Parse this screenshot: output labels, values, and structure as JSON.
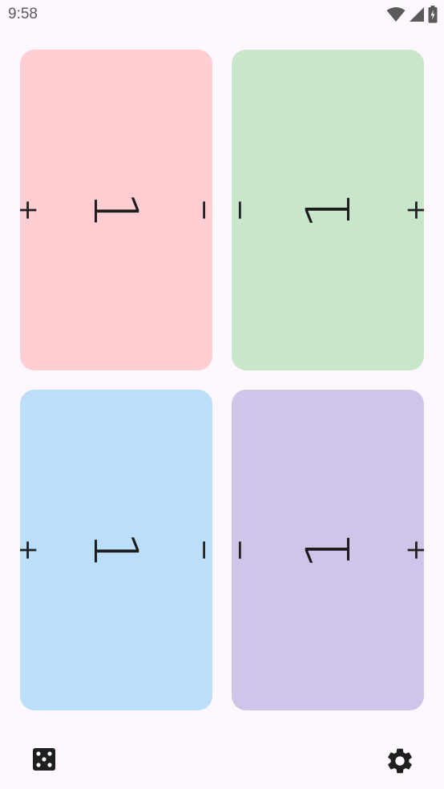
{
  "status_bar": {
    "time": "9:58",
    "icons": [
      "wifi-icon",
      "cellular-signal-icon",
      "battery-charging-icon"
    ]
  },
  "players": [
    {
      "name": "player-1",
      "color": "#FFCDD2",
      "life": "1",
      "decrement_label": "−",
      "increment_label": "+",
      "orientation": "rotated-clockwise"
    },
    {
      "name": "player-2",
      "color": "#C8E6C9",
      "life": "1",
      "decrement_label": "−",
      "increment_label": "+",
      "orientation": "rotated-counterclockwise"
    },
    {
      "name": "player-3",
      "color": "#BBDEFB",
      "life": "1",
      "decrement_label": "−",
      "increment_label": "+",
      "orientation": "rotated-clockwise"
    },
    {
      "name": "player-4",
      "color": "#D1C4E9",
      "life": "1",
      "decrement_label": "−",
      "increment_label": "+",
      "orientation": "rotated-counterclockwise"
    }
  ],
  "bottom_bar": {
    "left_icon": "dice-icon",
    "right_icon": "gear-icon"
  },
  "colors": {
    "background": "#FFF7FE",
    "icon": "#5a5a5a"
  }
}
